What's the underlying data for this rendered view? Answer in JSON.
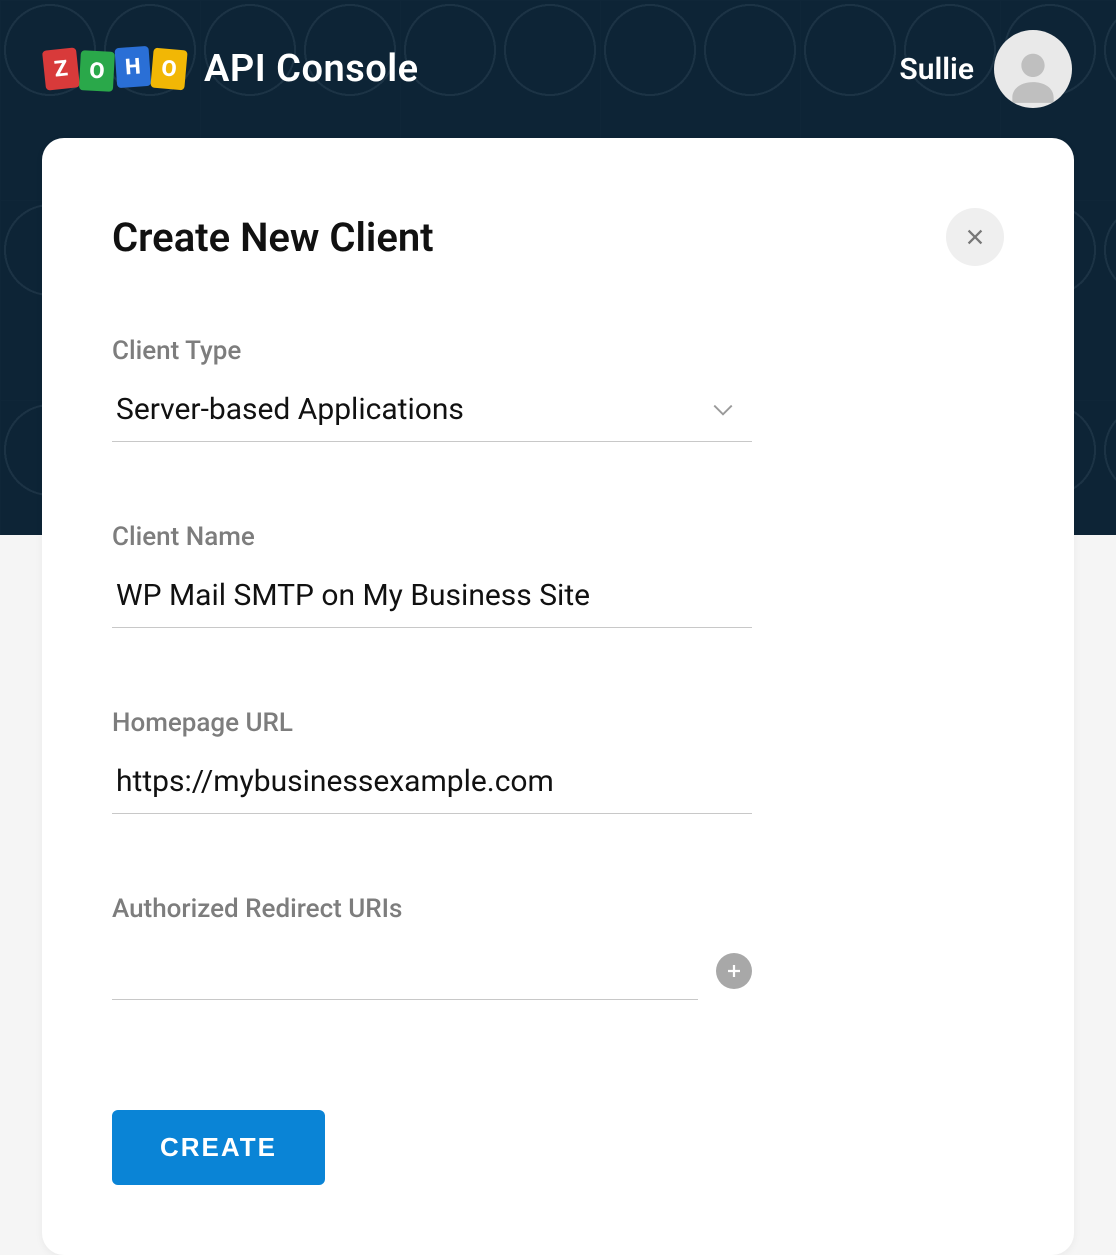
{
  "header": {
    "logo_letters": [
      "Z",
      "O",
      "H",
      "O"
    ],
    "brand_text": "API Console",
    "user_name": "Sullie"
  },
  "card": {
    "title": "Create New Client",
    "fields": {
      "client_type": {
        "label": "Client Type",
        "value": "Server-based Applications"
      },
      "client_name": {
        "label": "Client Name",
        "value": "WP Mail SMTP on My Business Site"
      },
      "homepage_url": {
        "label": "Homepage URL",
        "value": "https://mybusinessexample.com"
      },
      "redirect_uris": {
        "label": "Authorized Redirect URIs",
        "value": ""
      }
    },
    "create_button": "CREATE"
  }
}
